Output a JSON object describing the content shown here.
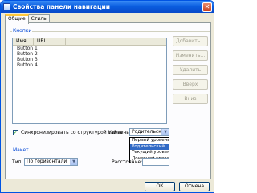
{
  "window": {
    "title": "Свойства панели навигации",
    "close_glyph": "✕"
  },
  "tabs": [
    {
      "label": "Общие"
    },
    {
      "label": "Стиль"
    }
  ],
  "buttons_group": {
    "label": "Кнопки"
  },
  "list": {
    "columns": [
      "Имя",
      "URL"
    ],
    "rows": [
      "Button 1",
      "Button 2",
      "Button 3",
      "Button 4"
    ]
  },
  "side_buttons": {
    "add": "Добавить...",
    "edit": "Изменить...",
    "delete": "Удалить",
    "up": "Вверх",
    "down": "Вниз"
  },
  "sync": {
    "checked": true,
    "check_glyph": "✓",
    "label": "Синхронизировать со структурой сайта"
  },
  "level": {
    "label": "Уровень:",
    "value": "Родительский",
    "options": [
      "Первый уровень",
      "Родительский",
      "Текущий уровень",
      "Дочерний уровень"
    ]
  },
  "layout_group": {
    "label": "Макет"
  },
  "type": {
    "label": "Тип:",
    "value": "По горизонтали"
  },
  "spacing": {
    "label": "Расстояние:",
    "value": ""
  },
  "footer": {
    "ok": "ОК",
    "cancel": "Отмена"
  },
  "colors": {
    "titlebar": "#0a5ee0",
    "selection": "#316ac5",
    "group_label": "#0046d5"
  }
}
